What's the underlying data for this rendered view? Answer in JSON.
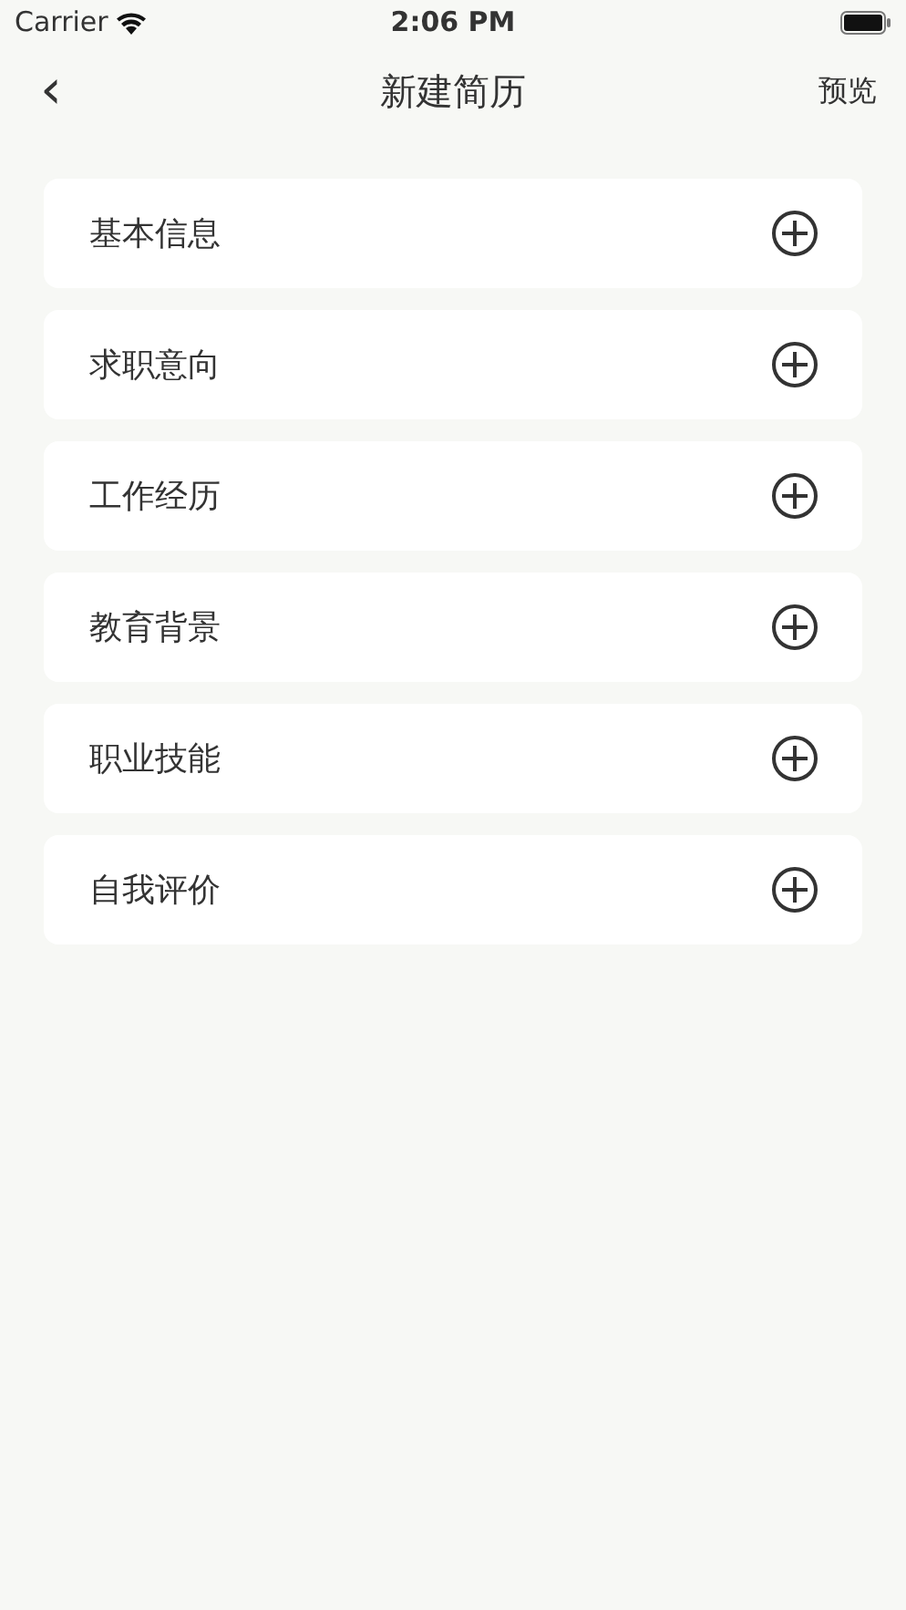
{
  "status_bar": {
    "carrier": "Carrier",
    "time": "2:06 PM"
  },
  "nav_bar": {
    "back": "‹",
    "title": "新建简历",
    "action": "预览"
  },
  "sections": [
    {
      "label": "基本信息"
    },
    {
      "label": "求职意向"
    },
    {
      "label": "工作经历"
    },
    {
      "label": "教育背景"
    },
    {
      "label": "职业技能"
    },
    {
      "label": "自我评价"
    }
  ]
}
